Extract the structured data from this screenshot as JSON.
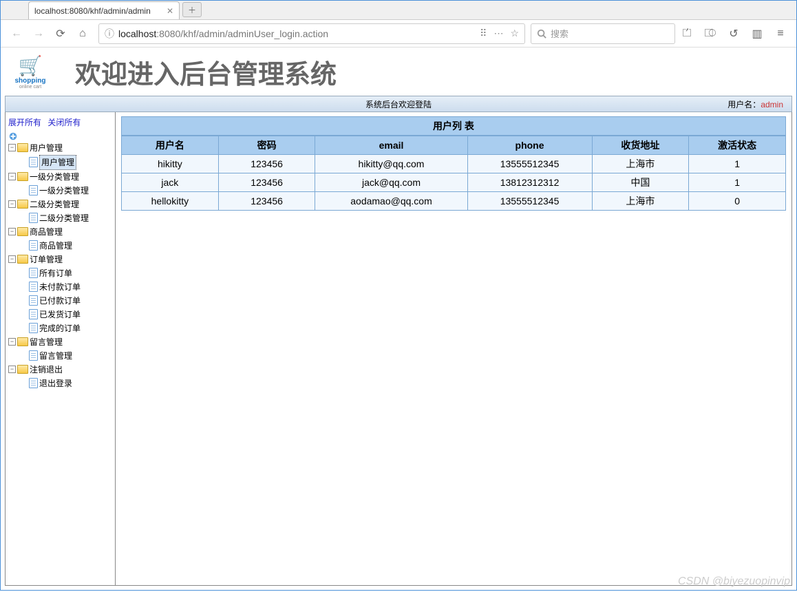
{
  "browser": {
    "tab_title": "localhost:8080/khf/admin/admin",
    "url_prefix": "localhost",
    "url_rest": ":8080/khf/admin/adminUser_login.action",
    "search_placeholder": "搜索"
  },
  "banner": {
    "logo_main": "shopping",
    "logo_sub": "online cart",
    "title": "欢迎进入后台管理系统"
  },
  "statusbar": {
    "welcome": "系统后台欢迎登陆",
    "user_label": "用户名：",
    "user_name": "admin"
  },
  "sidebar": {
    "expand_all": "展开所有",
    "collapse_all": "关闭所有",
    "groups": [
      {
        "label": "用户管理",
        "children": [
          {
            "label": "用户管理",
            "selected": true
          }
        ]
      },
      {
        "label": "一级分类管理",
        "children": [
          {
            "label": "一级分类管理"
          }
        ]
      },
      {
        "label": "二级分类管理",
        "children": [
          {
            "label": "二级分类管理"
          }
        ]
      },
      {
        "label": "商品管理",
        "children": [
          {
            "label": "商品管理"
          }
        ]
      },
      {
        "label": "订单管理",
        "children": [
          {
            "label": "所有订单"
          },
          {
            "label": "未付款订单"
          },
          {
            "label": "已付款订单"
          },
          {
            "label": "已发货订单"
          },
          {
            "label": "完成的订单"
          }
        ]
      },
      {
        "label": "留言管理",
        "children": [
          {
            "label": "留言管理"
          }
        ]
      },
      {
        "label": "注销退出",
        "children": [
          {
            "label": "退出登录"
          }
        ]
      }
    ]
  },
  "table": {
    "title": "用户列 表",
    "headers": [
      "用户名",
      "密码",
      "email",
      "phone",
      "收货地址",
      "激活状态"
    ],
    "rows": [
      [
        "hikitty",
        "123456",
        "hikitty@qq.com",
        "13555512345",
        "上海市",
        "1"
      ],
      [
        "jack",
        "123456",
        "jack@qq.com",
        "13812312312",
        "中国",
        "1"
      ],
      [
        "hellokitty",
        "123456",
        "aodamao@qq.com",
        "13555512345",
        "上海市",
        "0"
      ]
    ]
  },
  "watermark": "CSDN @biyezuopinvip"
}
